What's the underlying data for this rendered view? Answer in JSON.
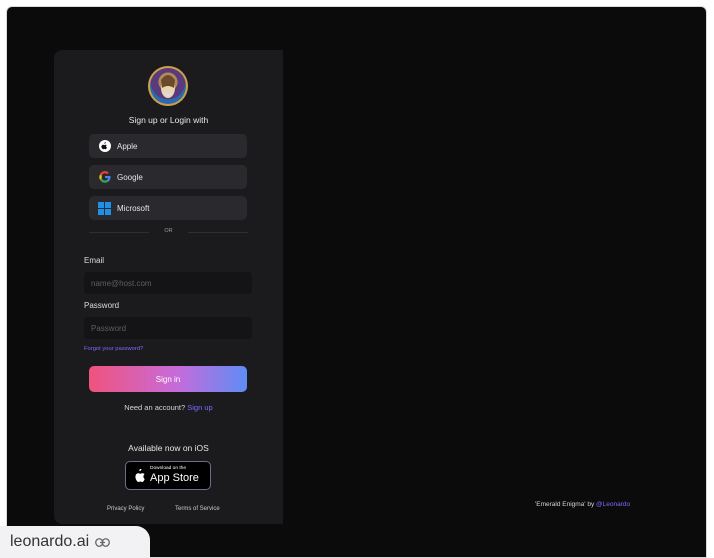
{
  "login": {
    "heading": "Sign up or Login with",
    "apple_label": "Apple",
    "google_label": "Google",
    "microsoft_label": "Microsoft",
    "or_text": "OR",
    "email_label": "Email",
    "email_placeholder": "name@host.com",
    "password_label": "Password",
    "password_placeholder": "Password",
    "forgot_label": "Forgot your password?",
    "signin_label": "Sign in",
    "need_account_text": "Need an account?",
    "signup_label": "Sign up",
    "ios_text": "Available now on iOS",
    "appstore_small": "Download on the",
    "appstore_big": "App Store",
    "privacy_label": "Privacy Policy",
    "terms_label": "Terms of Service"
  },
  "credit": {
    "title_text": "'Emerald Enigma' by",
    "author_handle": "@Leonardo"
  },
  "browser": {
    "url": "leonardo.ai"
  },
  "colors": {
    "accent": "#7b6bff",
    "gradient_start": "#f0537d",
    "gradient_end": "#5f8cf5",
    "background": "#0b0b0c",
    "panel": "#1b1b1e"
  },
  "icons": [
    "apple-icon",
    "google-icon",
    "microsoft-icon",
    "link-icon",
    "avatar-logo"
  ]
}
